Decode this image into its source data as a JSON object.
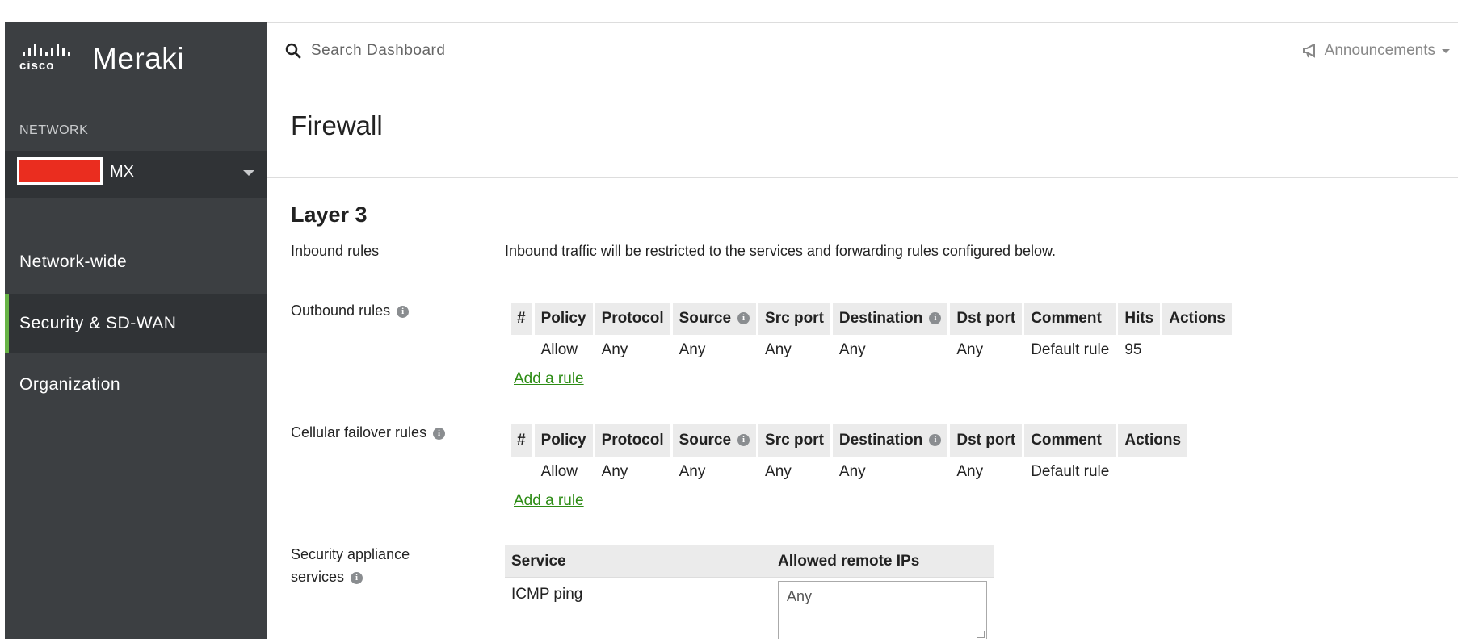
{
  "brand": {
    "company": "cisco",
    "product": "Meraki"
  },
  "sidebar": {
    "network_label": "NETWORK",
    "network_name": "MX",
    "items": [
      {
        "label": "Network-wide",
        "active": false
      },
      {
        "label": "Security & SD-WAN",
        "active": true
      },
      {
        "label": "Organization",
        "active": false
      }
    ]
  },
  "topbar": {
    "search_placeholder": "Search Dashboard",
    "announcements": "Announcements"
  },
  "page": {
    "title": "Firewall",
    "section": "Layer 3"
  },
  "inbound": {
    "label": "Inbound rules",
    "text": "Inbound traffic will be restricted to the services and forwarding rules configured below."
  },
  "outbound": {
    "label": "Outbound rules",
    "headers": [
      "#",
      "Policy",
      "Protocol",
      "Source",
      "Src port",
      "Destination",
      "Dst port",
      "Comment",
      "Hits",
      "Actions"
    ],
    "rows": [
      [
        "",
        "Allow",
        "Any",
        "Any",
        "Any",
        "Any",
        "Any",
        "Default rule",
        "95",
        ""
      ]
    ],
    "add_label": "Add a rule"
  },
  "cellular": {
    "label": "Cellular failover rules",
    "headers": [
      "#",
      "Policy",
      "Protocol",
      "Source",
      "Src port",
      "Destination",
      "Dst port",
      "Comment",
      "Actions"
    ],
    "rows": [
      [
        "",
        "Allow",
        "Any",
        "Any",
        "Any",
        "Any",
        "Any",
        "Default rule",
        ""
      ]
    ],
    "add_label": "Add a rule"
  },
  "services": {
    "label_line1": "Security appliance",
    "label_line2": "services",
    "headers": [
      "Service",
      "Allowed remote IPs"
    ],
    "rows": [
      {
        "service": "ICMP ping",
        "allowed": "Any"
      }
    ]
  },
  "colors": {
    "sidebar_bg": "#3c3f42",
    "active_accent": "#67b346",
    "link": "#2d8c15",
    "redaction": "#ea2d1f"
  }
}
